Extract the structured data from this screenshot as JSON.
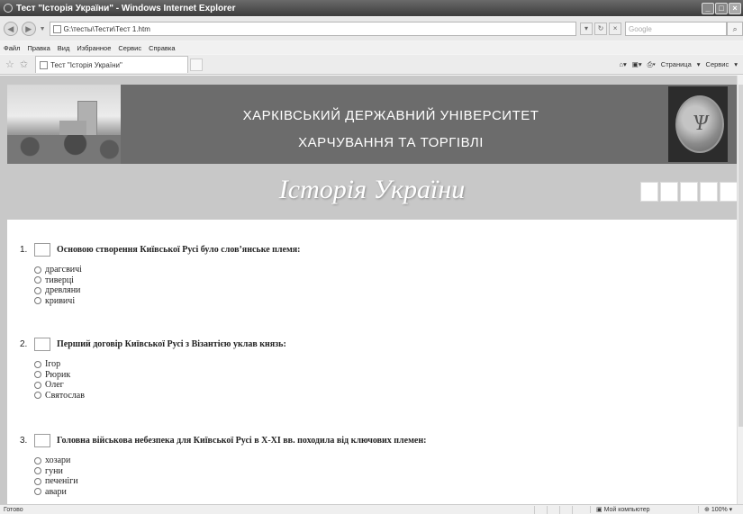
{
  "window": {
    "title": "Тест \"Історія України\" - Windows Internet Explorer"
  },
  "address": {
    "url": "G:\\тесты\\Тести\\Тест 1.htm",
    "search_placeholder": "Google"
  },
  "menu": [
    "Файл",
    "Правка",
    "Вид",
    "Избранное",
    "Сервис",
    "Справка"
  ],
  "tab": {
    "label": "Тест \"Історія України\""
  },
  "command_bar": {
    "page": "Страница",
    "tools": "Сервис"
  },
  "banner": {
    "line1": "ХАРКІВСЬКИЙ ДЕРЖАВНИЙ УНІВЕРСИТЕТ",
    "line2": "ХАРЧУВАННЯ ТА ТОРГІВЛІ"
  },
  "subject": {
    "title": "Історія України"
  },
  "questions": [
    {
      "number": "1.",
      "text": "Основою створення Київської Русі було слов’янське племя:",
      "options": [
        "драгсвичі",
        "тиверці",
        "древляни",
        "кривичі"
      ]
    },
    {
      "number": "2.",
      "text": "Перший договір Київської Русі з Візантією уклав князь:",
      "options": [
        "Ігор",
        "Рюрик",
        "Олег",
        "Святослав"
      ]
    },
    {
      "number": "3.",
      "text": "Головна військова небезпека для Київської Русі в X-XI вв. походила від ключових племен:",
      "options": [
        "хозари",
        "гуни",
        "печеніги",
        "авари"
      ]
    }
  ],
  "status": {
    "text": "Готово",
    "zone": "Мой компьютер",
    "zoom": "100%"
  },
  "colors": {
    "banner": "#6c6c6c",
    "background": "#c8c8c8",
    "sheet": "#ffffff"
  }
}
